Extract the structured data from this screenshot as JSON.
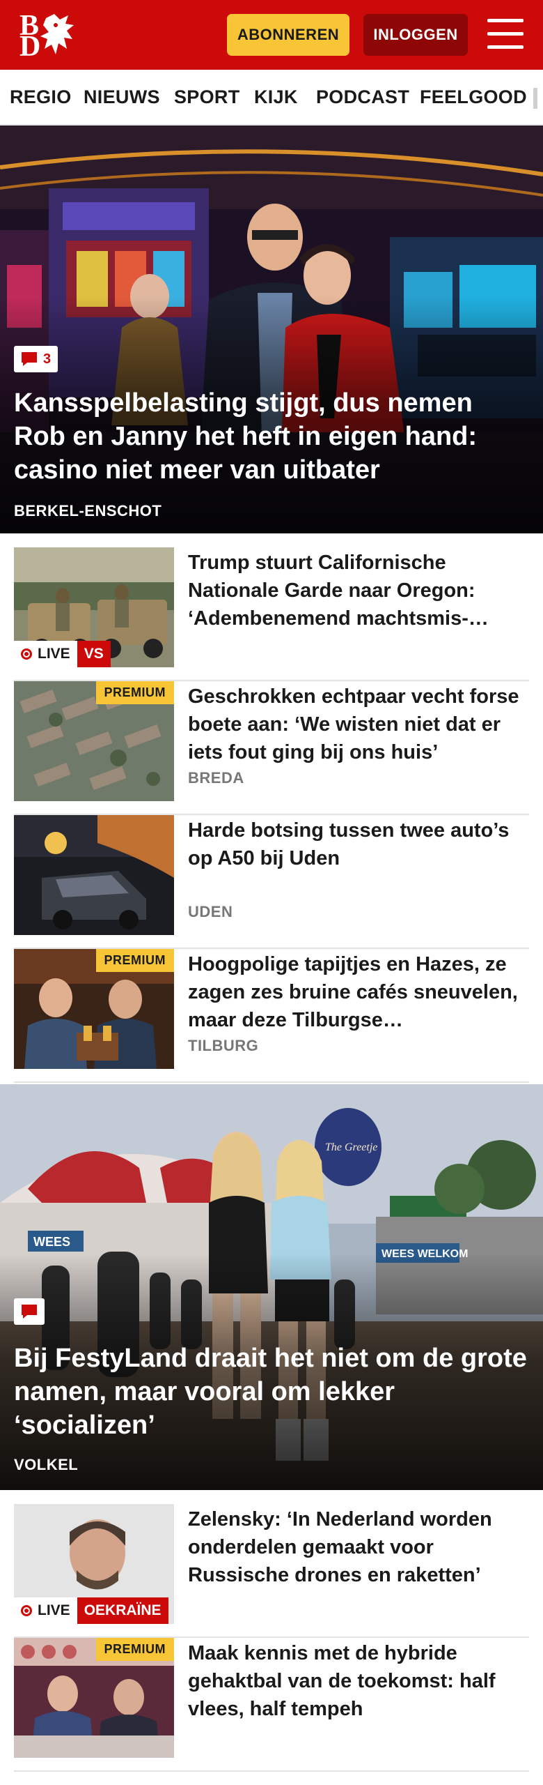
{
  "header": {
    "logo_top": "B",
    "logo_bottom": "D",
    "subscribe_label": "ABONNEREN",
    "login_label": "INLOGGEN",
    "menu_icon": "hamburger-menu-icon",
    "brand_color": "#cc0a0a",
    "accent_color": "#f7c535"
  },
  "nav": {
    "items": [
      "REGIO",
      "NIEUWS",
      "SPORT",
      "KIJK",
      "PODCAST",
      "FEELGOOD"
    ]
  },
  "hero1": {
    "comments": "3",
    "title": "Kansspelbelasting stijgt, dus nemen Rob en Janny het heft in eigen hand: casino niet meer van uitbater",
    "location": "BERKEL-ENSCHOT"
  },
  "articles1": [
    {
      "title": "Trump stuurt Californische Nationale Garde naar Oregon: ‘Adembenemend machtsmis-…",
      "live": "LIVE",
      "tag": "VS"
    },
    {
      "title": "Geschrokken echtpaar vecht forse boete aan: ‘We wisten niet dat er iets fout ging bij ons huis’",
      "premium": "PREMIUM",
      "location": "BREDA"
    },
    {
      "title": "Harde botsing tussen twee auto’s op A50 bij Uden",
      "location": "UDEN"
    },
    {
      "title": "Hoogpolige tapijtjes en Hazes, ze zagen zes bruine cafés sneuvelen, maar deze Tilburgse…",
      "premium": "PREMIUM",
      "location": "TILBURG"
    }
  ],
  "hero2": {
    "title": "Bij FestyLand draait het niet om de grote namen, maar vooral om lekker ‘socializen’",
    "location": "VOLKEL",
    "tent_sign": "WEES WELKOM",
    "balloon_text": "The Greetje"
  },
  "articles2": [
    {
      "title": "Zelensky: ‘In Nederland worden onderdelen gemaakt voor Russische drones en raketten’",
      "live": "LIVE",
      "tag": "OEKRAÏNE"
    },
    {
      "title": "Maak kennis met de hybride gehaktbal van de toekomst: half vlees, half tempeh",
      "premium": "PREMIUM"
    }
  ]
}
